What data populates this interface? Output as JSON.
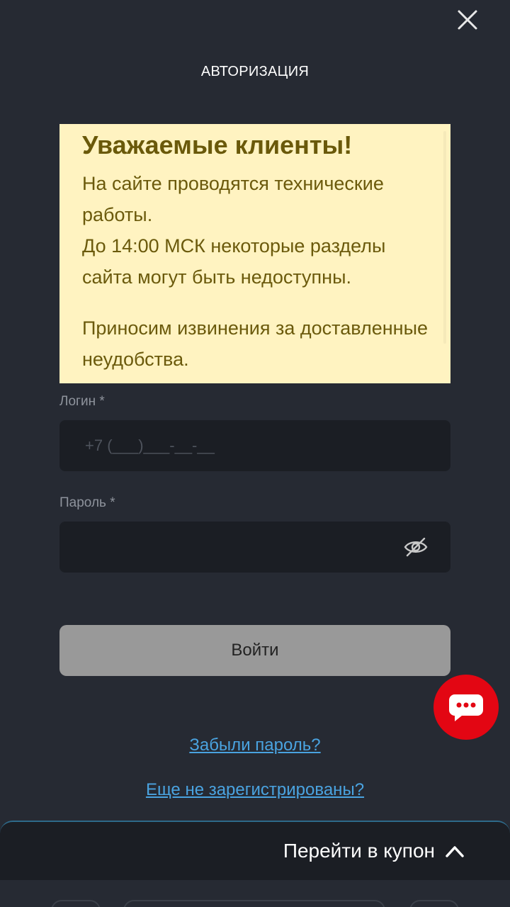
{
  "header": {
    "title": "АВТОРИЗАЦИЯ",
    "close_icon": "close-icon"
  },
  "notice": {
    "title": "Уважаемые клиенты!",
    "line1": "На сайте проводятся технические работы.",
    "line2": "До 14:00 МСК некоторые разделы сайта могут быть недоступны.",
    "line3": "Приносим извинения за доставленные неудобства.",
    "bg_color": "#fff3c1",
    "text_color": "#6b5a0c"
  },
  "form": {
    "login_label": "Логин *",
    "login_placeholder": "+7 (___)___-__-__",
    "login_value": "",
    "password_label": "Пароль *",
    "password_placeholder": "",
    "password_value": "",
    "submit_label": "Войти"
  },
  "links": {
    "forgot_password": "Забыли пароль?",
    "register": "Еще не зарегистрированы?"
  },
  "coupon": {
    "label": "Перейти в купон"
  },
  "colors": {
    "background": "#262a33",
    "field": "#1b1e24",
    "button": "#999999",
    "link": "#4aa3e0",
    "chat": "#e30613"
  }
}
